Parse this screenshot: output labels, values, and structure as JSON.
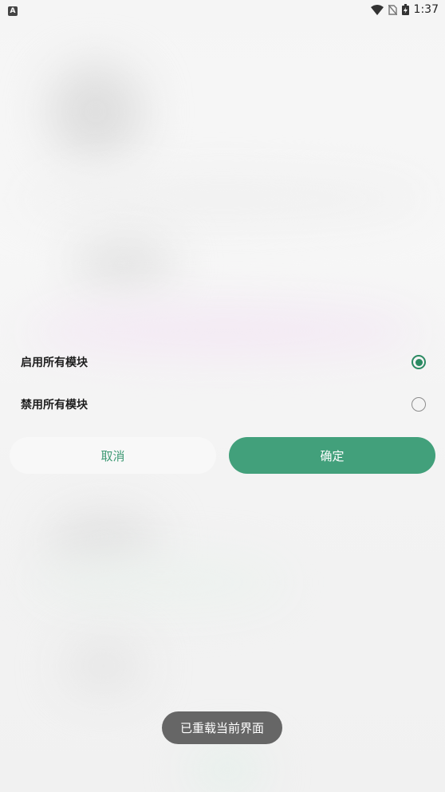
{
  "status_bar": {
    "app_badge": "A",
    "time": "1:37",
    "icons": [
      "wifi-icon",
      "no-sim-icon",
      "battery-charging-icon"
    ]
  },
  "options": [
    {
      "label": "启用所有模块",
      "checked": true
    },
    {
      "label": "禁用所有模块",
      "checked": false
    }
  ],
  "buttons": {
    "cancel_label": "取消",
    "confirm_label": "确定"
  },
  "toast": {
    "message": "已重载当前界面"
  },
  "colors": {
    "accent": "#42a07b",
    "radio_checked": "#2b8a62",
    "cancel_text": "#3f9a75",
    "toast_bg": "#666666"
  }
}
